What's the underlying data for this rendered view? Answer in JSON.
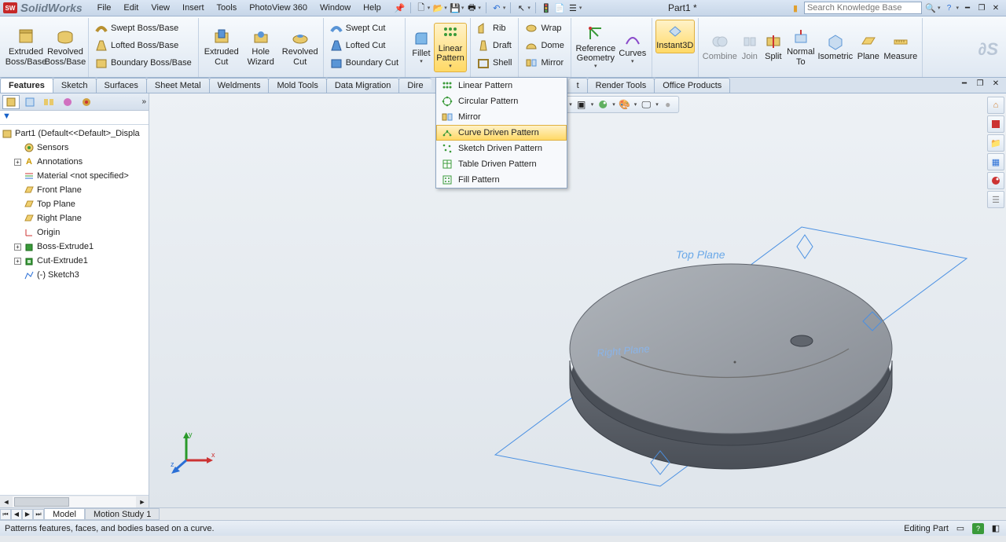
{
  "app": {
    "name": "SolidWorks",
    "doc": "Part1 *"
  },
  "menu": {
    "file": "File",
    "edit": "Edit",
    "view": "View",
    "insert": "Insert",
    "tools": "Tools",
    "photoview": "PhotoView 360",
    "window": "Window",
    "help": "Help"
  },
  "search": {
    "placeholder": "Search Knowledge Base"
  },
  "ribbon": {
    "extruded_boss": "Extruded\nBoss/Base",
    "revolved_boss": "Revolved\nBoss/Base",
    "swept_boss": "Swept Boss/Base",
    "lofted_boss": "Lofted Boss/Base",
    "boundary_boss": "Boundary Boss/Base",
    "extruded_cut": "Extruded\nCut",
    "hole_wizard": "Hole\nWizard",
    "revolved_cut": "Revolved\nCut",
    "swept_cut": "Swept Cut",
    "lofted_cut": "Lofted Cut",
    "boundary_cut": "Boundary Cut",
    "fillet": "Fillet",
    "linear_pattern": "Linear\nPattern",
    "rib": "Rib",
    "draft": "Draft",
    "shell": "Shell",
    "wrap": "Wrap",
    "dome": "Dome",
    "mirror": "Mirror",
    "ref_geom": "Reference\nGeometry",
    "curves": "Curves",
    "instant3d": "Instant3D",
    "combine": "Combine",
    "join": "Join",
    "split": "Split",
    "normal_to": "Normal\nTo",
    "isometric": "Isometric",
    "plane": "Plane",
    "measure": "Measure"
  },
  "tabs": {
    "features": "Features",
    "sketch": "Sketch",
    "surfaces": "Surfaces",
    "sheet_metal": "Sheet Metal",
    "weldments": "Weldments",
    "mold_tools": "Mold Tools",
    "data_migration": "Data Migration",
    "direct": "Dire",
    "t2": "t",
    "render": "Render Tools",
    "office": "Office Products"
  },
  "pattern_menu": {
    "linear": "Linear Pattern",
    "circular": "Circular Pattern",
    "mirror": "Mirror",
    "curve": "Curve Driven Pattern",
    "sketch": "Sketch Driven Pattern",
    "table": "Table Driven Pattern",
    "fill": "Fill Pattern"
  },
  "tree": {
    "root": "Part1  (Default<<Default>_Displa",
    "sensors": "Sensors",
    "annotations": "Annotations",
    "material": "Material <not specified>",
    "front": "Front Plane",
    "top": "Top Plane",
    "right": "Right Plane",
    "origin": "Origin",
    "boss": "Boss-Extrude1",
    "cut": "Cut-Extrude1",
    "sketch3": "(-) Sketch3",
    "filter": "▼"
  },
  "viewport": {
    "top_plane": "Top Plane",
    "right_plane": "Right Plane"
  },
  "bottom_tabs": {
    "model": "Model",
    "motion": "Motion Study 1"
  },
  "status": {
    "hint": "Patterns features, faces, and bodies based on a curve.",
    "mode": "Editing Part"
  },
  "triad": {
    "x": "x",
    "y": "y",
    "z": "z"
  }
}
